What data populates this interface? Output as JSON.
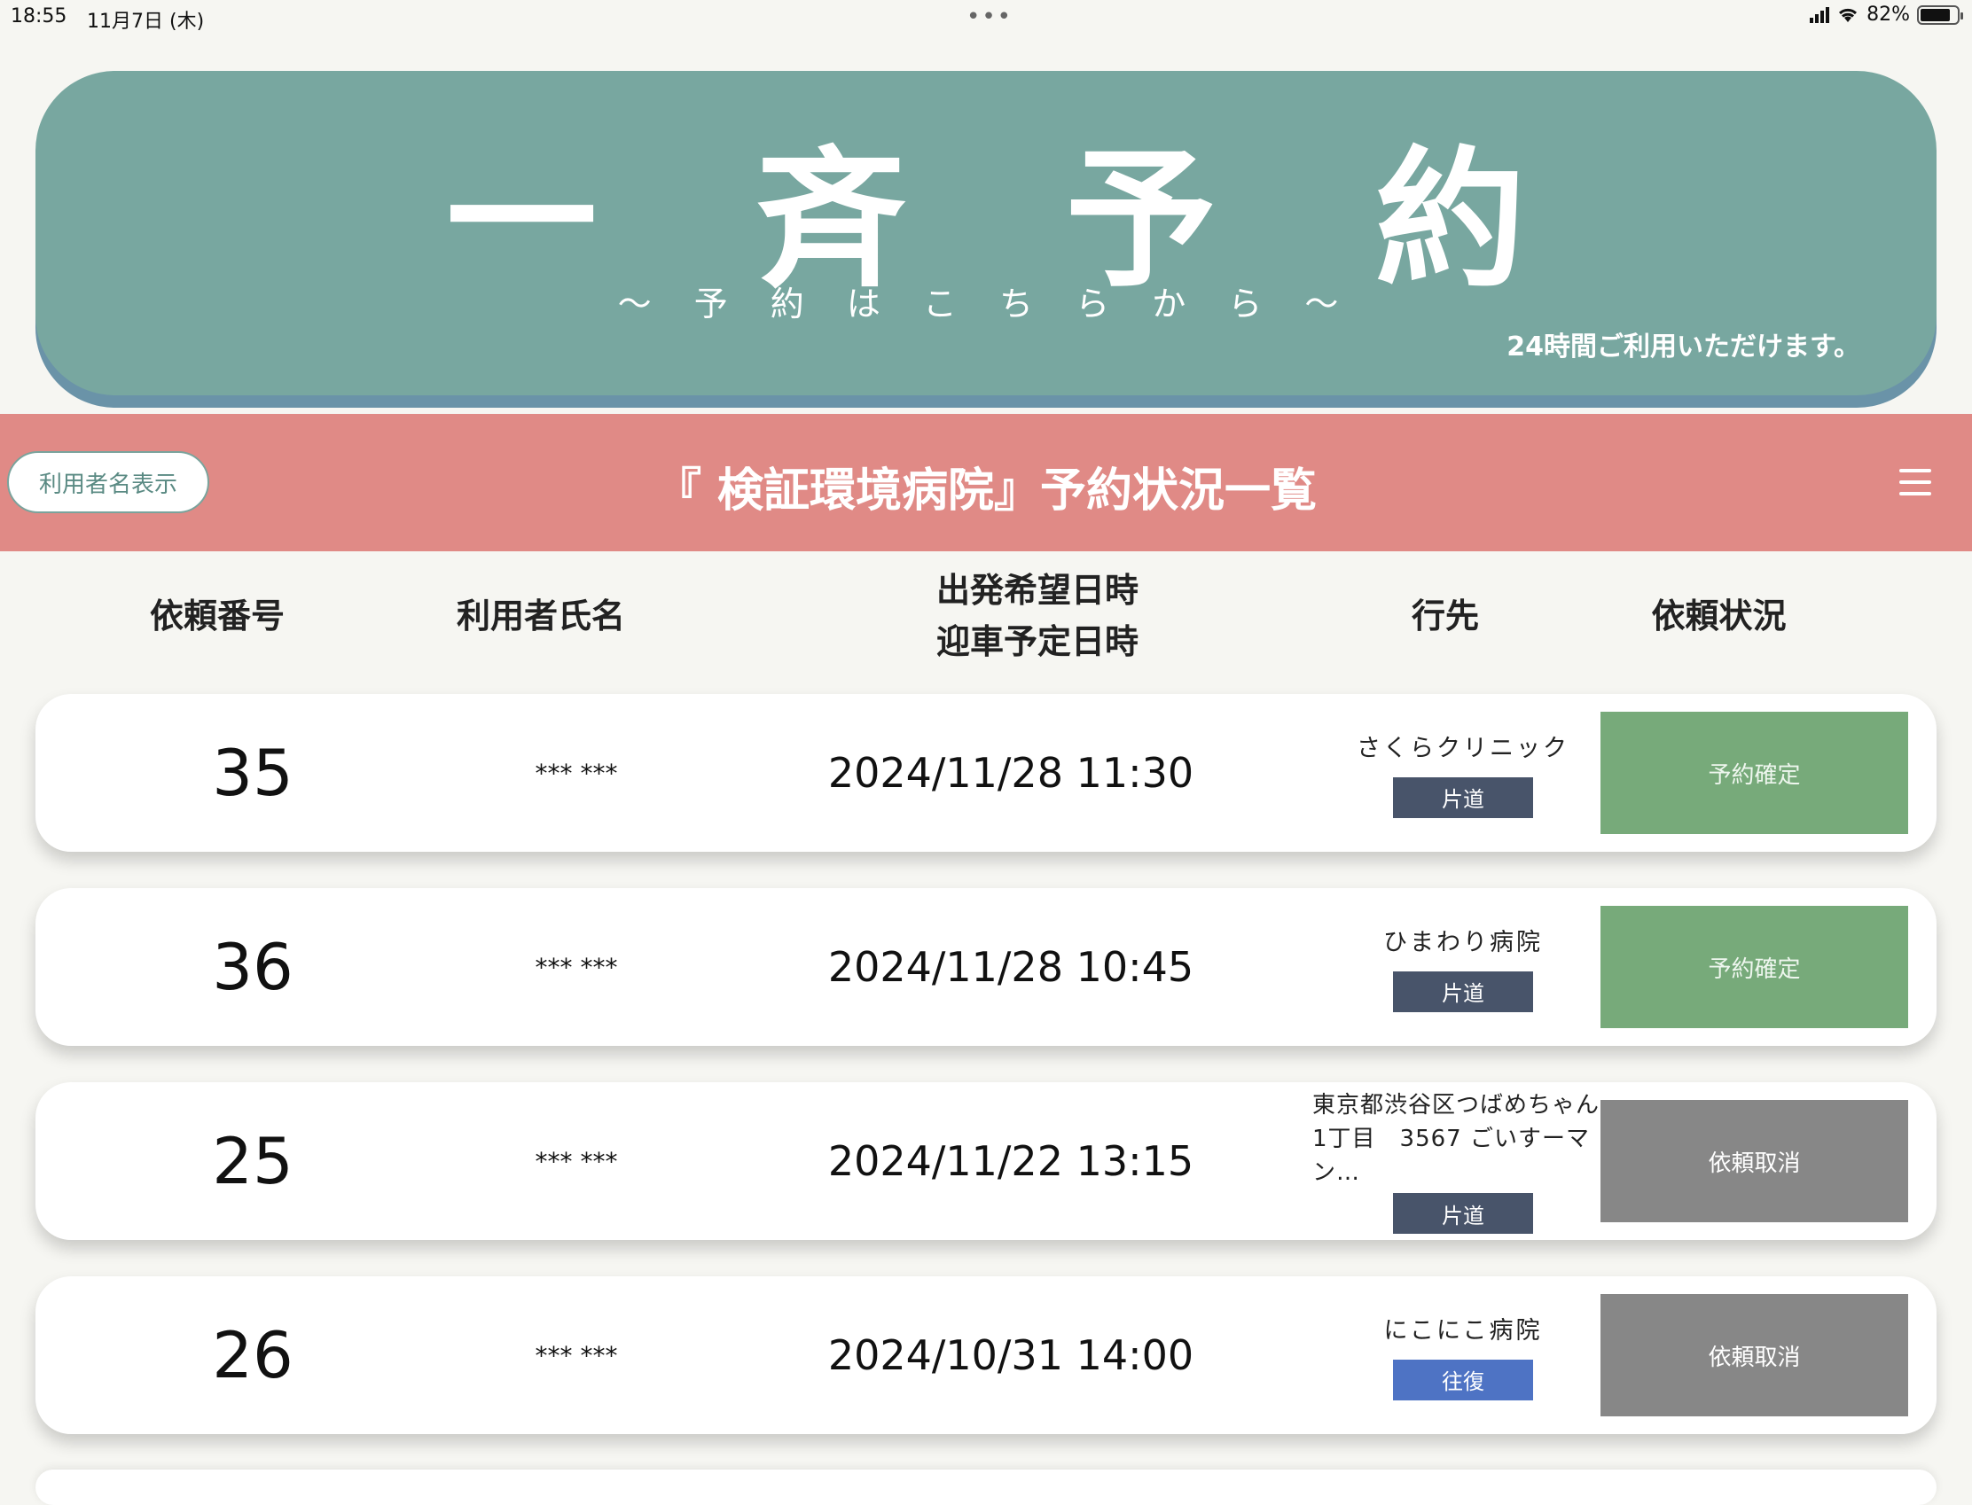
{
  "status_bar": {
    "time": "18:55",
    "date": "11月7日 (木)",
    "dots": "•••",
    "battery": "82%",
    "battery_level": 0.82
  },
  "hero": {
    "title": "一 斉 予 約",
    "subtitle": "〜 予 約 は こ ち ら か ら 〜",
    "note": "24時間ご利用いただけます。"
  },
  "banner": {
    "toggle_label": "利用者名表示",
    "title": "『 検証環境病院』予約状況一覧"
  },
  "columns": {
    "number": "依頼番号",
    "name": "利用者氏名",
    "datetime_line1": "出発希望日時",
    "datetime_line2": "迎車予定日時",
    "destination": "行先",
    "status": "依頼状況"
  },
  "rows": [
    {
      "number": "35",
      "name": "*** ***",
      "datetime": "2024/11/28 11:30",
      "destination": "さくらクリニック",
      "trip": "片道",
      "status": "予約確定"
    },
    {
      "number": "36",
      "name": "*** ***",
      "datetime": "2024/11/28 10:45",
      "destination": "ひまわり病院",
      "trip": "片道",
      "status": "予約確定"
    },
    {
      "number": "25",
      "name": "*** ***",
      "datetime": "2024/11/22 13:15",
      "destination": "東京都渋谷区つばめちゃん1丁目　3567 ごいすーマン…",
      "trip": "片道",
      "status": "依頼取消"
    },
    {
      "number": "26",
      "name": "*** ***",
      "datetime": "2024/10/31 14:00",
      "destination": "にこにこ病院",
      "trip": "往復",
      "status": "依頼取消"
    }
  ],
  "colors": {
    "hero": "#78a7a0",
    "banner": "#e08a86",
    "confirmed": "#77aa7a",
    "cancelled": "#878787",
    "oneway": "#48546a",
    "roundtrip": "#4e73c4"
  }
}
